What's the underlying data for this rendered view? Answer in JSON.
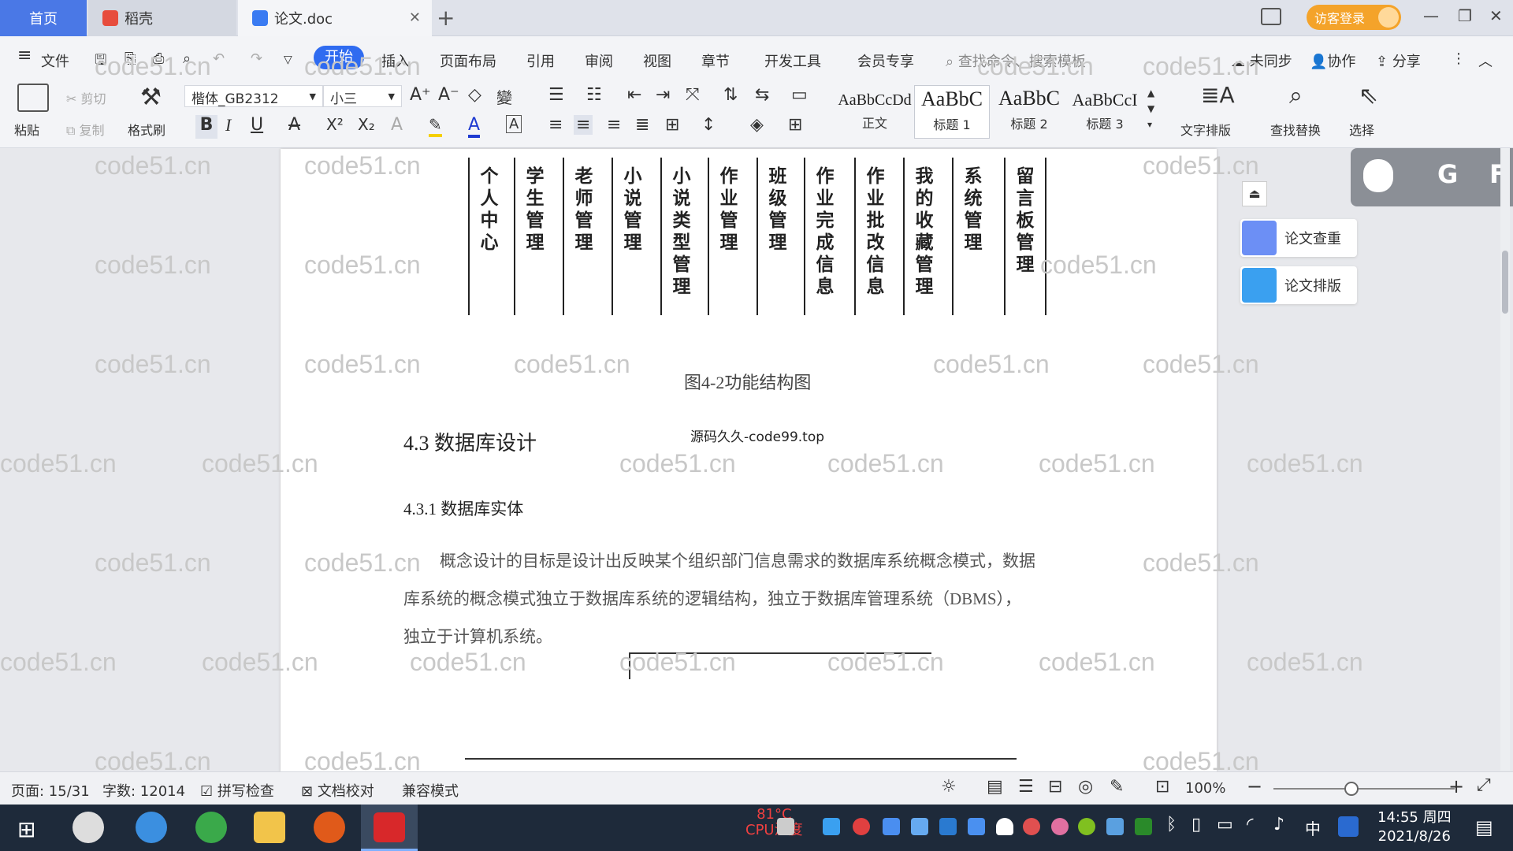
{
  "tabs": {
    "home": "首页",
    "daoke": "稻壳",
    "doc": "论文.doc"
  },
  "login": "访客登录",
  "menu": {
    "file": "文件",
    "start": "开始",
    "insert": "插入",
    "layout": "页面布局",
    "ref": "引用",
    "review": "审阅",
    "view": "视图",
    "chapter": "章节",
    "dev": "开发工具",
    "member": "会员专享",
    "search": "查找命令、搜索模板",
    "sync": "未同步",
    "collab": "协作",
    "share": "分享"
  },
  "ribbon": {
    "paste": "粘贴",
    "cut": "剪切",
    "copy": "复制",
    "format_painter": "格式刷",
    "font": "楷体_GB2312",
    "size": "小三",
    "styles": [
      {
        "preview": "AaBbCcDd",
        "label": "正文"
      },
      {
        "preview": "AaBbC",
        "label": "标题 1"
      },
      {
        "preview": "AaBbC",
        "label": "标题 2"
      },
      {
        "preview": "AaBbCcI",
        "label": "标题 3"
      }
    ],
    "text_layout": "文字排版",
    "find_replace": "查找替换",
    "select": "选择"
  },
  "side": {
    "check": "论文查重",
    "format": "论文排版"
  },
  "doc": {
    "modules": [
      "个人中心",
      "学生管理",
      "老师管理",
      "小说管理",
      "小说类型管理",
      "作业管理",
      "班级管理",
      "作业完成信息",
      "作业批改信息",
      "我的收藏管理",
      "系统管理",
      "留言板管理"
    ],
    "figure_caption": "图4-2功能结构图",
    "source": "源码久久-code99.top",
    "h2": "4.3 数据库设计",
    "h3": "4.3.1 数据库实体",
    "para": [
      "概念设计的目标是设计出反映某个组织部门信息需求的数据库系统概念模式，数据",
      "库系统的概念模式独立于数据库系统的逻辑结构，独立于数据库管理系统（DBMS），",
      "独立于计算机系统。"
    ]
  },
  "watermark": "code51.cn",
  "status": {
    "page": "页面: 15/31",
    "words": "字数: 12014",
    "spell": "拼写检查",
    "proof": "文档校对",
    "compat": "兼容模式",
    "zoom": "100%"
  },
  "taskbar": {
    "temp": "81°C",
    "cpu": "CPU温度",
    "time": "14:55 周四",
    "date": "2021/8/26",
    "ime": "中"
  }
}
